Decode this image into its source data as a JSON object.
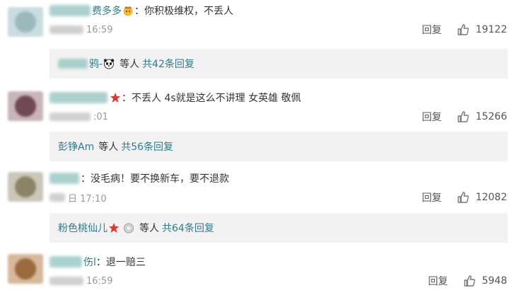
{
  "comments": [
    {
      "name_suffix": "费多多",
      "text": "：你积极维权，不丢人",
      "time": "16:59",
      "reply_label": "回复",
      "likes": "19122",
      "sub": {
        "user": "",
        "user_suffix": "鸦-",
        "etc": "等人",
        "count": "共42条回复"
      }
    },
    {
      "name_suffix": "",
      "text": "：不丢人 4s就是这么不讲理 女英雄 敬佩",
      "time": ":01",
      "reply_label": "回复",
      "likes": "15266",
      "sub": {
        "user": "彭铮Am",
        "etc": "等人",
        "count": "共56条回复"
      }
    },
    {
      "name_suffix": "",
      "text": "：没毛病！要不换新车，要不退款",
      "time": "日 17:10",
      "reply_label": "回复",
      "likes": "12082",
      "sub": {
        "user": "粉色桃仙儿",
        "etc": "等人",
        "count": "共64条回复"
      }
    },
    {
      "name_suffix": "伤l",
      "text": "：退一赔三",
      "time": "16:59",
      "reply_label": "回复",
      "likes": "5948"
    }
  ],
  "colors": {
    "link": "#2a7d8f",
    "meta": "#999999",
    "reply_bg": "#f2f2f2"
  },
  "icons": [
    "thumb-up-icon",
    "fire-face-icon",
    "red-star-icon",
    "panda-icon",
    "silver-medal-icon"
  ]
}
